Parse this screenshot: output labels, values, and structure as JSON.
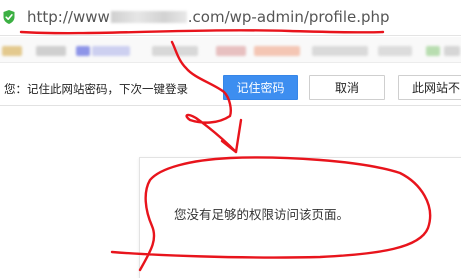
{
  "browser": {
    "url_prefix": "http://www",
    "url_suffix": ".com/wp-admin/profile.php",
    "shield_icon": "shield-check-icon",
    "shield_color": "#3cb043"
  },
  "infobar": {
    "prompt": "您：记住此网站密码，下次一键登录",
    "save_label": "记住密码",
    "cancel_label": "取消",
    "never_label": "此网站不"
  },
  "page": {
    "message": "您没有足够的权限访问该页面。"
  },
  "colors": {
    "accent": "#3d8ef0",
    "annotation": "#e8141c"
  }
}
